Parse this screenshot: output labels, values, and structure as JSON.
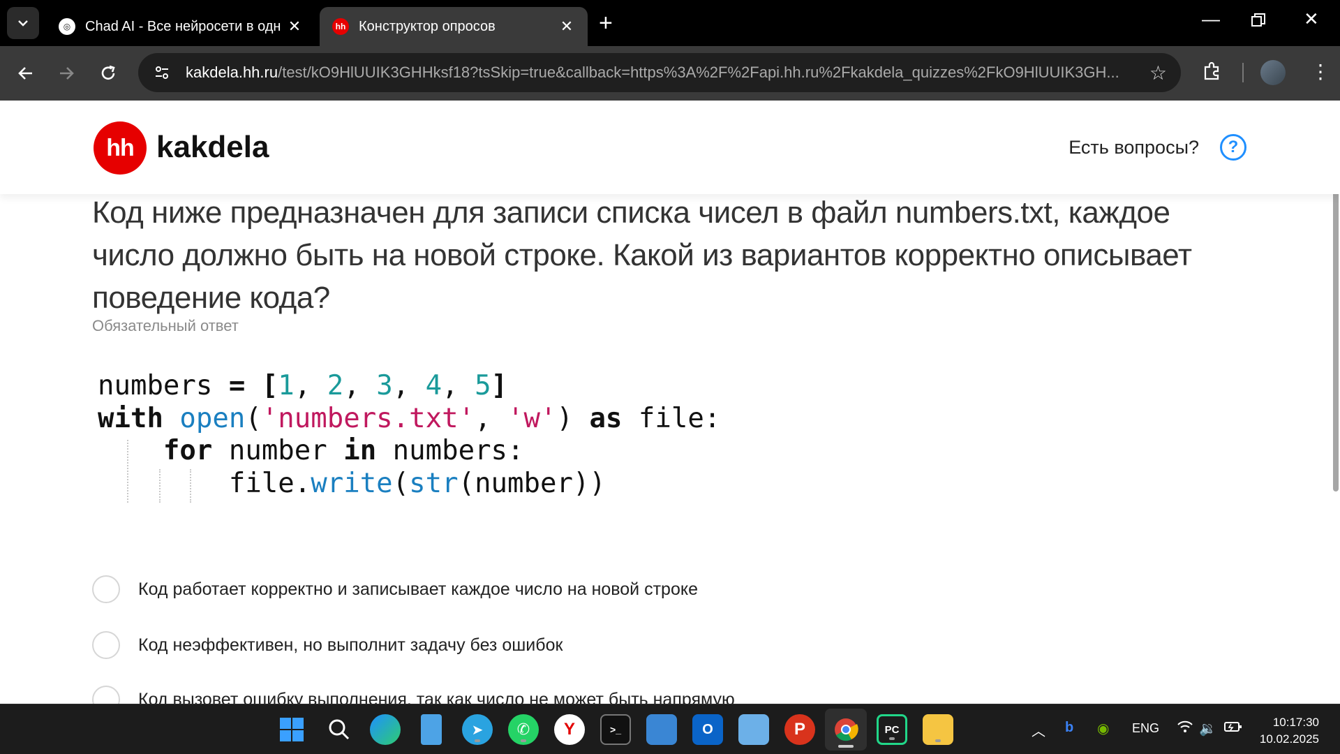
{
  "browser": {
    "tabs": [
      {
        "title": "Chad AI - Все нейросети в одн",
        "active": false
      },
      {
        "title": "Конструктор опросов",
        "active": true
      }
    ],
    "url_domain": "kakdela.hh.ru",
    "url_path": "/test/kO9HlUUIK3GHHksf18?tsSkip=true&callback=https%3A%2F%2Fapi.hh.ru%2Fkakdela_quizzes%2FkO9HlUUIK3GH..."
  },
  "header": {
    "logo_mark": "hh",
    "logo_text": "kakdela",
    "help_text": "Есть вопросы?",
    "help_icon": "?"
  },
  "question": {
    "text": "Код ниже предназначен для записи списка чисел в файл numbers.txt, каждое число должно быть на новой строке. Какой из вариантов корректно описывает поведение кода?",
    "required_label": "Обязательный ответ"
  },
  "code": {
    "l1_var": "numbers",
    "l1_eq": " = [",
    "n1": "1",
    "n2": "2",
    "n3": "3",
    "n4": "4",
    "n5": "5",
    "sep": ", ",
    "l1_close": "]",
    "l2_with": "with",
    "l2_open": "open",
    "l2_str1": "'numbers.txt'",
    "l2_str2": "'w'",
    "l2_as": "as",
    "l2_file": " file:",
    "l3_for": "for",
    "l3_number": " number ",
    "l3_in": "in",
    "l3_numbers": " numbers:",
    "l4_file": "file.",
    "l4_write": "write",
    "l4_str": "str",
    "l4_arg": "(number))"
  },
  "answers": [
    "Код работает корректно и записывает каждое число на новой строке",
    "Код неэффективен, но выполнит задачу без ошибок",
    "Код вызовет ошибку выполнения, так как число не может быть напрямую"
  ],
  "taskbar": {
    "apps": [
      "start-icon",
      "search-icon",
      "edge-icon",
      "notepad-icon",
      "telegram-icon",
      "whatsapp-icon",
      "yandex-browser-icon",
      "terminal-icon",
      "photos-icon",
      "outlook-icon",
      "control-panel-icon",
      "psiphon-icon",
      "chrome-icon",
      "pycharm-icon",
      "file-explorer-icon"
    ],
    "language": "ENG",
    "time": "10:17:30",
    "date": "10.02.2025"
  }
}
